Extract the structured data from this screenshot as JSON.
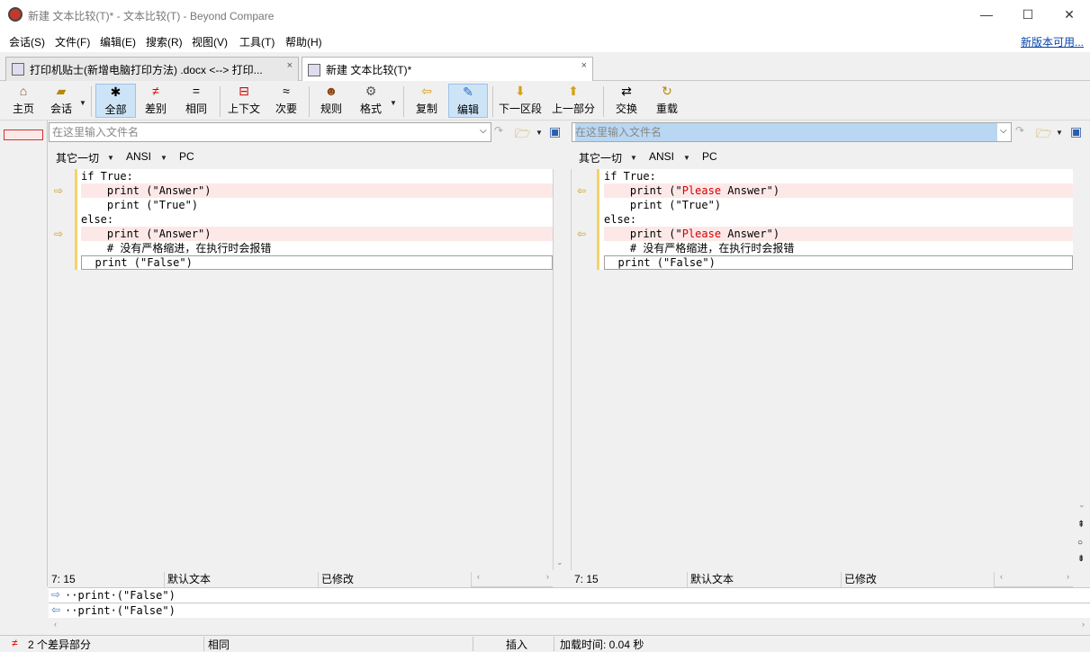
{
  "window": {
    "title": "新建 文本比较(T)* - 文本比较(T) - Beyond Compare",
    "controls": {
      "minimize": "—",
      "maximize": "☐",
      "close": "✕"
    }
  },
  "menu": {
    "items": [
      "会话(S)",
      "文件(F)",
      "编辑(E)",
      "搜索(R)",
      "视图(V)",
      "工具(T)",
      "帮助(H)"
    ],
    "update_link": "新版本可用..."
  },
  "tabs": [
    {
      "label": "打印机贴士(新增电脑打印方法) .docx <--> 打印...",
      "close": "×"
    },
    {
      "label": "新建 文本比较(T)*",
      "close": "×"
    }
  ],
  "toolbar": {
    "home": "主页",
    "session": "会话",
    "all": "全部",
    "diffs": "差别",
    "same": "相同",
    "context": "上下文",
    "minor": "次要",
    "rules": "规则",
    "format": "格式",
    "copy": "复制",
    "edit": "编辑",
    "next_section": "下一区段",
    "prev_section": "上一部分",
    "swap": "交换",
    "reload": "重载"
  },
  "left": {
    "filename_placeholder": "在这里输入文件名",
    "format": "其它一切",
    "encoding": "ANSI",
    "lineend": "PC",
    "lines": [
      "if True:",
      "    print (\"Answer\")",
      "    print (\"True\")",
      "else:",
      "    print (\"Answer\")",
      "    # 没有严格缩进，在执行时会报错",
      "  print (\"False\")"
    ],
    "status": {
      "pos": "7: 15",
      "mode": "默认文本",
      "state": "已修改"
    }
  },
  "right": {
    "filename_placeholder": "在这里输入文件名",
    "format": "其它一切",
    "encoding": "ANSI",
    "lineend": "PC",
    "lines": {
      "l1": "if True:",
      "l2_pre": "    print (\"",
      "l2_red": "Please",
      "l2_post": " Answer\")",
      "l3": "    print (\"True\")",
      "l4": "else:",
      "l5_pre": "    print (\"",
      "l5_red": "Please",
      "l5_post": " Answer\")",
      "l6": "    # 没有严格缩进，在执行时会报错",
      "l7": "  print (\"False\")"
    },
    "status": {
      "pos": "7: 15",
      "mode": "默认文本",
      "state": "已修改"
    }
  },
  "detail": {
    "line_left": "··print·(\"False\")",
    "line_right": "··print·(\"False\")"
  },
  "statusbar": {
    "diff_count": "2 个差异部分",
    "same": "相同",
    "insert": "插入",
    "load_time": "加载时间:  0.04 秒"
  },
  "colors": {
    "diff_row": "#fde8e8",
    "diff_text": "#d40000",
    "accent": "#cde4f7"
  }
}
